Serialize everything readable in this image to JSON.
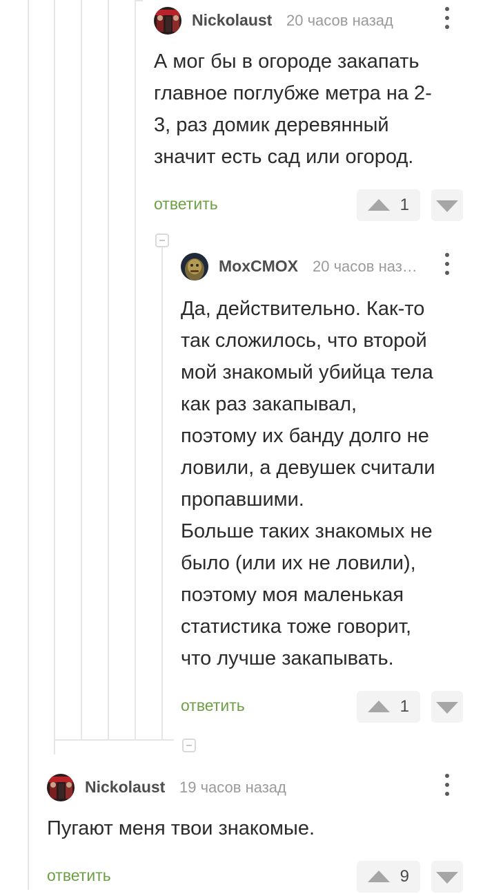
{
  "comments": [
    {
      "username": "Nickolaust",
      "time": "20 часов назад",
      "body": "А мог бы в огороде закапать\nглавное поглубже метра на 2-\n3, раз домик деревянный\nзначит есть сад или огород.",
      "reply_label": "ответить",
      "votes": "1"
    },
    {
      "username": "MoxCMOX",
      "time": "20 часов наз…",
      "body": "Да, действительно. Как-то\nтак сложилось, что второй\nмой знакомый убийца тела\nкак раз закапывал,\nпоэтому их банду долго не\nловили, а девушек считали\nпропавшими.\nБольше таких знакомых не\nбыло (или их не ловили),\nпоэтому моя маленькая\nстатистика тоже говорит,\nчто лучше закапывать.",
      "reply_label": "ответить",
      "votes": "1"
    },
    {
      "username": "Nickolaust",
      "time": "19 часов назад",
      "body": "Пугают меня твои знакомые.",
      "reply_label": "ответить",
      "votes": "9"
    }
  ],
  "colors": {
    "accent_reply": "#6da045",
    "thread_line": "#e6e6e6",
    "vote_bg": "#f3f3f3"
  },
  "icons": [
    "collapse-thread-icon",
    "more-options-icon",
    "upvote-icon",
    "downvote-icon"
  ]
}
